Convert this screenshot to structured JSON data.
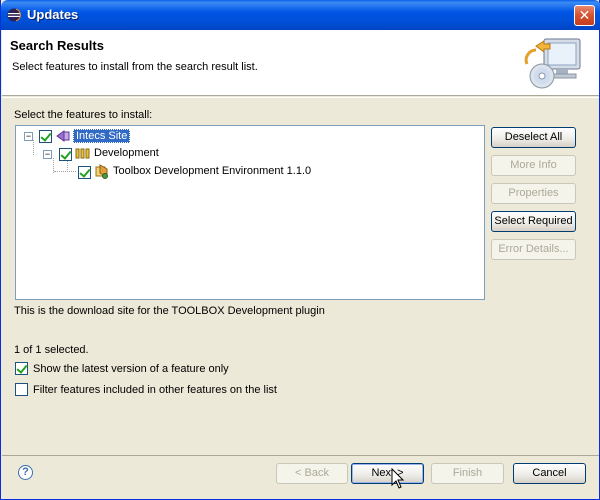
{
  "window": {
    "title": "Updates",
    "close_glyph": "✕"
  },
  "header": {
    "title": "Search Results",
    "description": "Select features to install from the search result list.",
    "graphic_icon": "monitor-cd-update-icon"
  },
  "tree_label": "Select the features to install:",
  "tree": {
    "nodes": [
      {
        "label": "Intecs Site",
        "checked": true,
        "expanded": true,
        "selected": true,
        "icon": "site-icon"
      },
      {
        "label": "Development",
        "checked": true,
        "expanded": true,
        "icon": "category-icon"
      },
      {
        "label": "Toolbox Development Environment 1.1.0",
        "checked": true,
        "icon": "feature-icon"
      }
    ],
    "expander_glyph": "−"
  },
  "side_buttons": {
    "deselect_all": "Deselect All",
    "more_info": "More Info",
    "properties": "Properties",
    "select_required": "Select Required",
    "error_details": "Error Details..."
  },
  "description_text": "This is the download site for the TOOLBOX Development plugin",
  "selection_count": "1 of 1 selected.",
  "options": {
    "latest_version": {
      "label": "Show the latest version of a feature only",
      "checked": true
    },
    "filter_included": {
      "label": "Filter features included in other features on the list",
      "checked": false
    }
  },
  "footer": {
    "help": "?",
    "back": "< Back",
    "next": "Next >",
    "finish": "Finish",
    "cancel": "Cancel"
  },
  "colors": {
    "selection": "#316ac5",
    "titlebar": "#0055e5"
  }
}
